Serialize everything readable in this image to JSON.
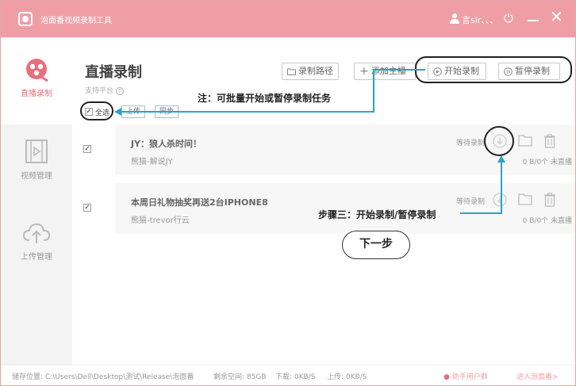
{
  "titlebar": {
    "app_title": "泡面番视频录制工具",
    "username": "言sir、、、"
  },
  "sidebar": {
    "items": [
      {
        "label": "直播录制",
        "icon": "live-record-icon",
        "active": true
      },
      {
        "label": "视频管理",
        "icon": "film-icon",
        "active": false
      },
      {
        "label": "上传管理",
        "icon": "cloud-upload-icon",
        "active": false
      }
    ]
  },
  "main": {
    "title": "直播录制",
    "support_label": "支持平台",
    "buttons": {
      "record_path": "录制路径",
      "add_streamer": "添加主播",
      "start_record": "开始录制",
      "pause_record": "暂停录制"
    },
    "select_all": "全选",
    "upload": "上传",
    "sync": "同步",
    "rows": [
      {
        "title": "JY：狼人杀时间！",
        "sub": "熊猫-解说JY",
        "status": "等待录制",
        "meta": "0 B/0个  未直播",
        "checked": true
      },
      {
        "title": "本周日礼物抽奖再送2台IPHONE8",
        "sub": "熊猫-trevor行云",
        "status": "等待录制",
        "meta": "0 B/0个  未直播",
        "checked": true
      }
    ]
  },
  "annotations": {
    "note": "注：可批量开始或暂停录制任务",
    "step": "步骤三：开始录制/暂停录制",
    "next": "下一步"
  },
  "statusbar": {
    "storage": "储存位置: C:\\Users\\Dell\\Desktop\\测试\\Release\\泡面番",
    "free_space": "剩余空间: 85GB",
    "download": "下载: 0KB/S",
    "upload": "上传: 0KB/S",
    "help_group": "助手用户群",
    "enter_site": "进入泡面番>"
  },
  "colors": {
    "brand": "#ef9ea6",
    "annotation_line": "#2aa3c8"
  }
}
